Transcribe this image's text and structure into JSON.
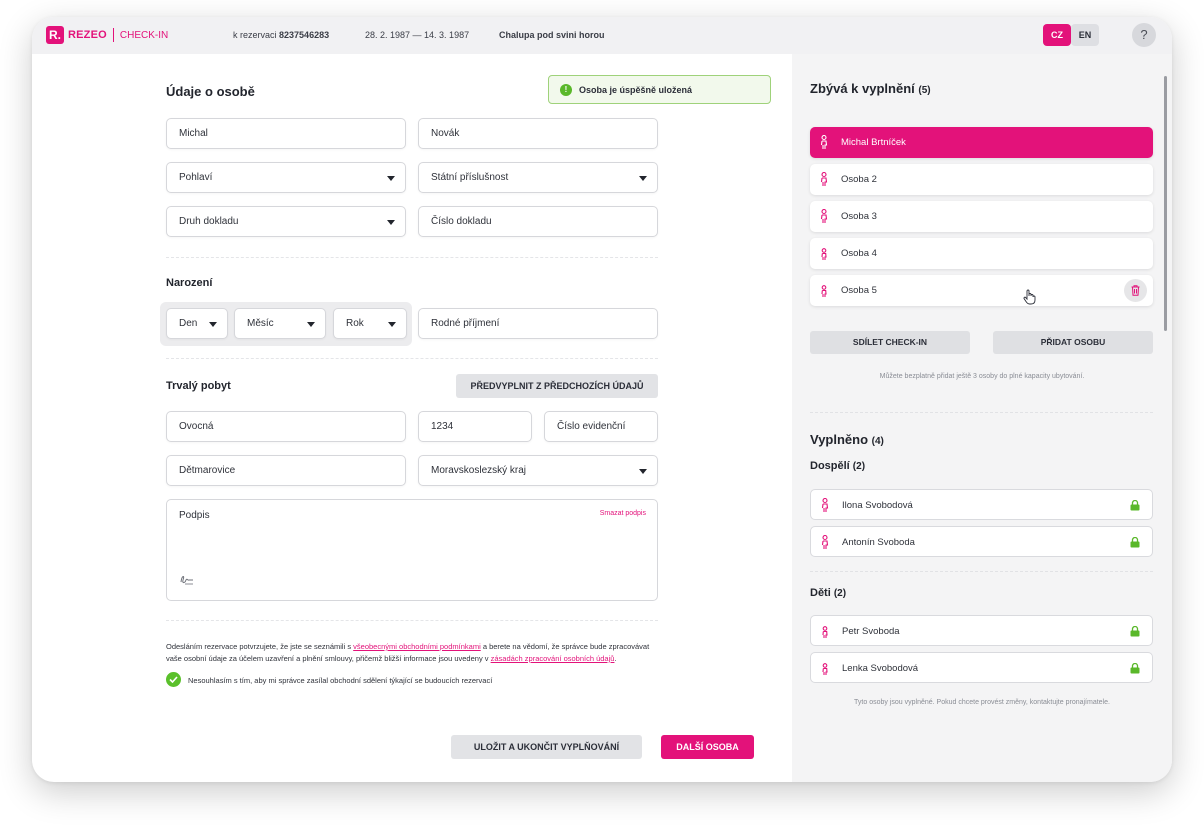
{
  "topbar": {
    "logo_mark": "R.",
    "logo_text": "REZEO",
    "logo_sub": "CHECK-IN",
    "reservation_prefix": "k rezervaci",
    "reservation_number": "8237546283",
    "dates": "28. 2. 1987 — 14. 3. 1987",
    "property": "Chalupa pod svini horou",
    "lang_cz": "CZ",
    "lang_en": "EN",
    "help": "?"
  },
  "toast": {
    "icon": "!",
    "text": "Osoba je úspěšně uložená",
    "color": "#5ab82a"
  },
  "person": {
    "title": "Údaje o osobě",
    "first_name": "Michal",
    "last_name": "Novák",
    "gender_placeholder": "Pohlaví",
    "nationality_placeholder": "Státní příslušnost",
    "doc_type_placeholder": "Druh dokladu",
    "doc_number_placeholder": "Číslo dokladu"
  },
  "birth": {
    "title": "Narození",
    "day": "Den",
    "month": "Měsíc",
    "year": "Rok",
    "maiden_name_placeholder": "Rodné příjmení"
  },
  "residence": {
    "title": "Trvalý pobyt",
    "prefill_button": "PŘEDVYPLNIT Z PŘEDCHOZÍCH ÚDAJŮ",
    "street": "Ovocná",
    "house_number": "1234",
    "registration_number_placeholder": "Číslo evidenční",
    "city": "Dětmarovice",
    "region": "Moravskoslezský kraj"
  },
  "signature": {
    "label": "Podpis",
    "clear": "Smazat podpis",
    "icon": "signature-icon"
  },
  "consent": {
    "line1_a": "Odesláním rezervace potvrzujete, že jste se seznámili s ",
    "line1_link": "všeobecnými obchodními podmínkami",
    "line1_b": " a berete na vědomí, že správce bude zpracovávat",
    "line2_a": "vaše osobní údaje za účelem uzavření a plnění smlouvy, přičemž bližší informace jsou uvedeny v ",
    "line2_link": "zásadách zpracování osobních údajů",
    "line2_b": ".",
    "checkbox_label": "Nesouhlasím s tím, aby mi správce zasílal obchodní sdělení týkající se budoucích rezervací"
  },
  "footer": {
    "save_button": "ULOŽIT A UKONČIT VYPLŇOVÁNÍ",
    "next_button": "DALŠÍ OSOBA"
  },
  "remaining": {
    "title": "Zbývá k vyplnění",
    "count": "(5)",
    "items": [
      {
        "name": "Michal Brtníček"
      },
      {
        "name": "Osoba 2"
      },
      {
        "name": "Osoba 3"
      },
      {
        "name": "Osoba 4"
      },
      {
        "name": "Osoba 5"
      }
    ],
    "share_button": "SDÍLET CHECK-IN",
    "add_button": "PŘIDAT OSOBU",
    "capacity_note": "Můžete bezplatně přidat ještě 3 osoby do plné kapacity ubytování."
  },
  "filled": {
    "title": "Vyplněno",
    "count": "(4)",
    "adults_title": "Dospělí",
    "adults_count": "(2)",
    "adults": [
      {
        "name": "Ilona Svobodová"
      },
      {
        "name": "Antonín Svoboda"
      }
    ],
    "children_title": "Děti",
    "children_count": "(2)",
    "children": [
      {
        "name": "Petr Svoboda"
      },
      {
        "name": "Lenka Svobodová"
      }
    ],
    "note": "Tyto osoby jsou vyplněné. Pokud chcete provést změny, kontaktujte pronajímatele."
  },
  "colors": {
    "accent": "#e3127a",
    "success": "#5ac02b",
    "lock": "#5ab82a"
  }
}
